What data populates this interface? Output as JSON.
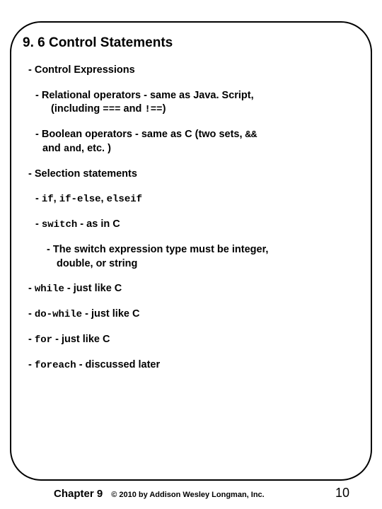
{
  "title": "9. 6 Control Statements",
  "lines": {
    "ctrl_expr": "- Control Expressions",
    "rel_a": "- Relational operators - same as Java. Script,",
    "rel_b_pre": "(including ",
    "rel_b_mid": " and ",
    "rel_b_post": ")",
    "op_eqeqeq": "===",
    "op_neqeq": "!==",
    "bool_a_pre": "- Boolean operators - same as C (two sets, ",
    "op_andand": "&&",
    "bool_b_pre": "and ",
    "op_and_word": "and",
    "bool_b_post": ", etc. )",
    "sel": "- Selection statements",
    "ifline_pre": "- ",
    "code_if": "if",
    "sep_comma_sp": ", ",
    "code_ifelse": "if-else",
    "code_elseif": "elseif",
    "switch_pre": "- ",
    "code_switch": "switch",
    "switch_post": " - as in C",
    "switch_note_a": "- The switch expression type must be integer,",
    "switch_note_b": "double, or string",
    "while_pre": "- ",
    "code_while": "while",
    "just_like_c": " - just like C",
    "code_dowhile": "do-while",
    "code_for": "for",
    "code_foreach": "foreach",
    "discussed": " - discussed later"
  },
  "footer": {
    "chapter": "Chapter 9",
    "copyright": "© 2010 by Addison Wesley Longman, Inc.",
    "page": "10"
  }
}
